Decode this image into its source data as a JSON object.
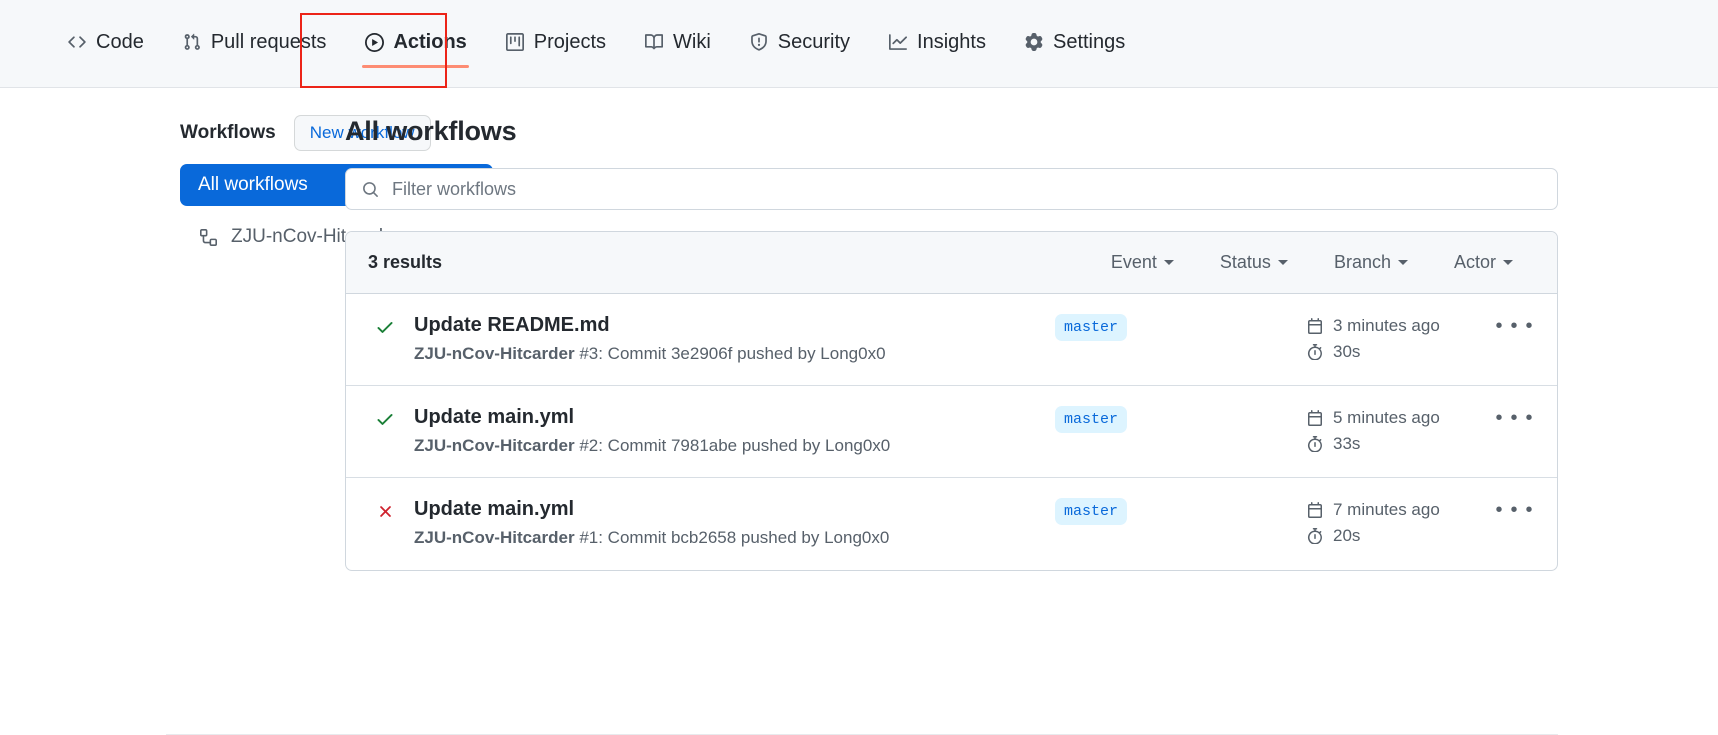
{
  "repo_nav": {
    "items": [
      {
        "label": "Code",
        "icon": "code-icon",
        "selected": false
      },
      {
        "label": "Pull requests",
        "icon": "git-pull-request-icon",
        "selected": false
      },
      {
        "label": "Actions",
        "icon": "play-circle-icon",
        "selected": true
      },
      {
        "label": "Projects",
        "icon": "project-board-icon",
        "selected": false
      },
      {
        "label": "Wiki",
        "icon": "book-icon",
        "selected": false
      },
      {
        "label": "Security",
        "icon": "shield-icon",
        "selected": false
      },
      {
        "label": "Insights",
        "icon": "graph-icon",
        "selected": false
      },
      {
        "label": "Settings",
        "icon": "gear-icon",
        "selected": false
      }
    ],
    "annotation_color": "#ec2418",
    "selected_underline_color": "#fd8c73"
  },
  "sidebar": {
    "title": "Workflows",
    "new_workflow_label": "New workflow",
    "items": [
      {
        "label": "All workflows",
        "icon": "none",
        "selected": true
      },
      {
        "label": "ZJU-nCov-Hitcarder",
        "icon": "workflow-icon",
        "selected": false
      }
    ],
    "selected_bg": "#0969da"
  },
  "main": {
    "title": "All workflows",
    "filter": {
      "placeholder": "Filter workflows",
      "value": "",
      "icon": "search-icon"
    },
    "results_header": {
      "count_label": "3 results",
      "dropdowns": [
        {
          "label": "Event"
        },
        {
          "label": "Status"
        },
        {
          "label": "Branch"
        },
        {
          "label": "Actor"
        }
      ]
    },
    "runs": [
      {
        "status": "success",
        "status_icon": "check-icon",
        "title": "Update README.md",
        "repo": "ZJU-nCov-Hitcarder",
        "subtitle_rest": " #3: Commit 3e2906f pushed by Long0x0",
        "branch": "master",
        "time_ago": "3 minutes ago",
        "duration": "30s",
        "menu_label": "• • •"
      },
      {
        "status": "success",
        "status_icon": "check-icon",
        "title": "Update main.yml",
        "repo": "ZJU-nCov-Hitcarder",
        "subtitle_rest": " #2: Commit 7981abe pushed by Long0x0",
        "branch": "master",
        "time_ago": "5 minutes ago",
        "duration": "33s",
        "menu_label": "• • •"
      },
      {
        "status": "failure",
        "status_icon": "x-icon",
        "title": "Update main.yml",
        "repo": "ZJU-nCov-Hitcarder",
        "subtitle_rest": " #1: Commit bcb2658 pushed by Long0x0",
        "branch": "master",
        "time_ago": "7 minutes ago",
        "duration": "20s",
        "menu_label": "• • •"
      }
    ],
    "colors": {
      "success": "#1a7f37",
      "failure": "#cf222e",
      "branch_badge_bg": "#ddf4ff",
      "branch_badge_fg": "#0969da",
      "link": "#0969da"
    }
  }
}
